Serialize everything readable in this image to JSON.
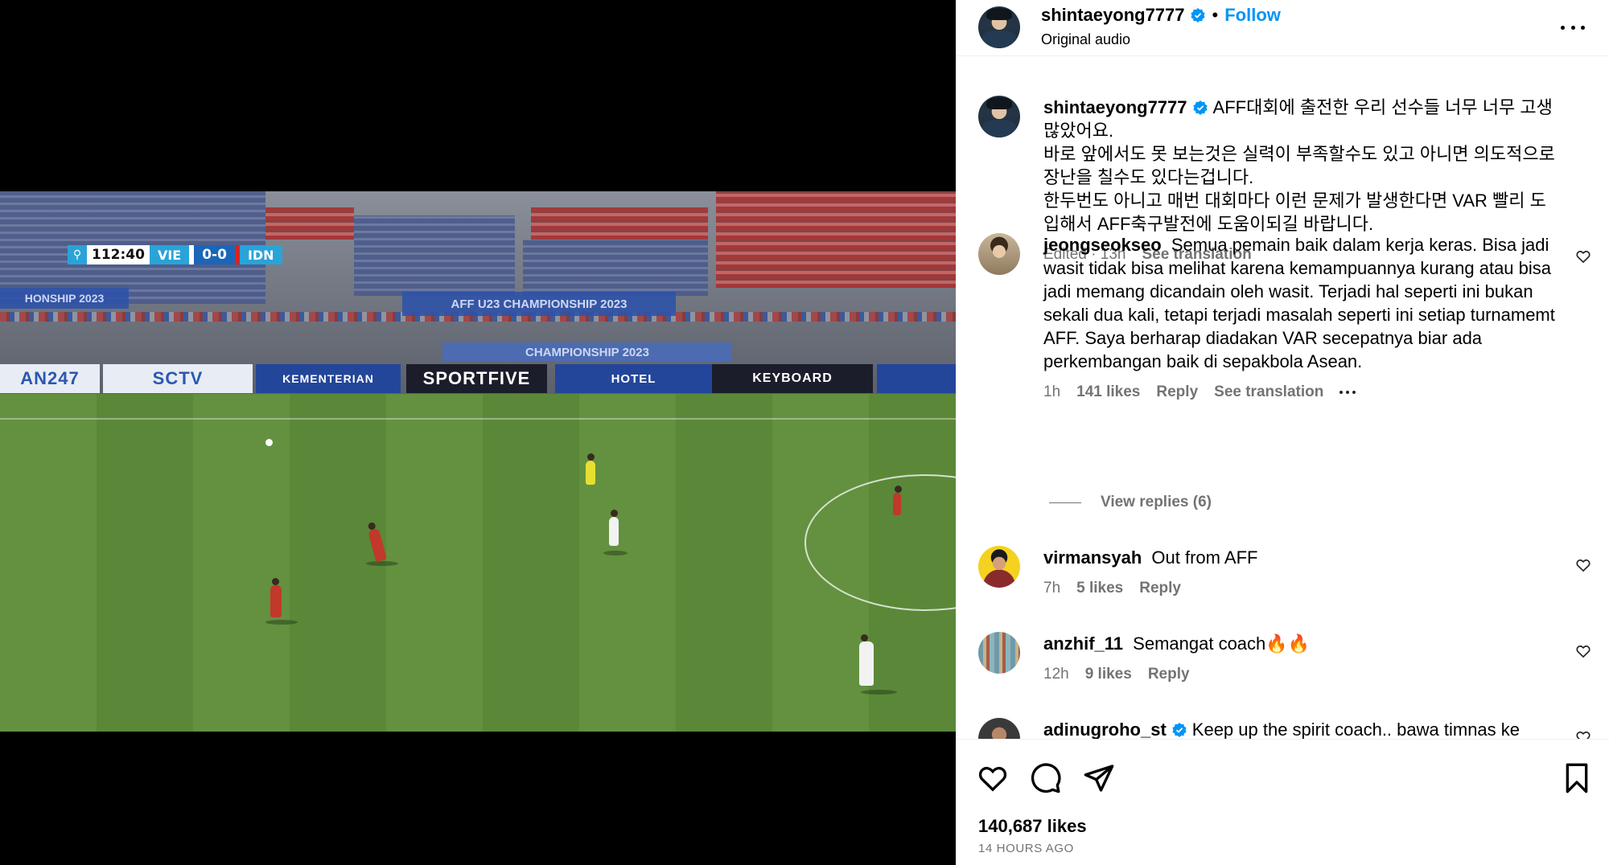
{
  "video": {
    "scoreboard": {
      "time": "112:40",
      "home": "VIE",
      "score": "0-0",
      "away": "IDN"
    },
    "boards": [
      "SPORTFIVE",
      "SCTV",
      "SCTV",
      "AFF U23 CHAMPIONSHIP 2023",
      "CHAMPIONSHIP 2023"
    ],
    "mute_icon": "speaker-muted-icon"
  },
  "header": {
    "username": "shintaeyong7777",
    "follow_label": "Follow",
    "audio_label": "Original audio"
  },
  "caption": {
    "username": "shintaeyong7777",
    "text": "AFF대회에 출전한 우리 선수들 너무 너무 고생 많았어요.",
    "line2": "바로 앞에서도 못 보는것은 실력이 부족할수도 있고 아니면 의도적으로 장난을 칠수도 있다는겁니다.",
    "line3": "한두번도 아니고 매번 대회마다 이런 문제가 발생한다면 VAR 빨리 도입해서 AFF축구발전에 도움이되길 바랍니다.",
    "edited": "Edited · 13h",
    "see_translation": "See translation"
  },
  "comments": [
    {
      "username": "jeongseokseo",
      "text": "Semua pemain baik dalam kerja keras. Bisa jadi wasit tidak bisa melihat karena kemampuannya kurang atau bisa jadi memang dicandain oleh wasit. Terjadi hal seperti ini bukan sekali dua kali, tetapi terjadi masalah seperti ini setiap turnamemt AFF. Saya berharap diadakan VAR secepatnya biar ada perkembangan baik di sepakbola Asean.",
      "time": "1h",
      "likes": "141 likes",
      "reply": "Reply",
      "see_translation": "See translation",
      "view_replies": "View replies (6)"
    },
    {
      "username": "virmansyah",
      "text": "Out from AFF",
      "time": "7h",
      "likes": "5 likes",
      "reply": "Reply"
    },
    {
      "username": "anzhif_11",
      "text": "Semangat coach🔥🔥",
      "time": "12h",
      "likes": "9 likes",
      "reply": "Reply"
    },
    {
      "username": "adinugroho_st",
      "text": "Keep up the spirit coach.. bawa timnas ke"
    }
  ],
  "footer": {
    "likes": "140,687 likes",
    "time": "14 HOURS AGO"
  },
  "colors": {
    "accent": "#0095f6",
    "secondary_text": "#737373"
  }
}
